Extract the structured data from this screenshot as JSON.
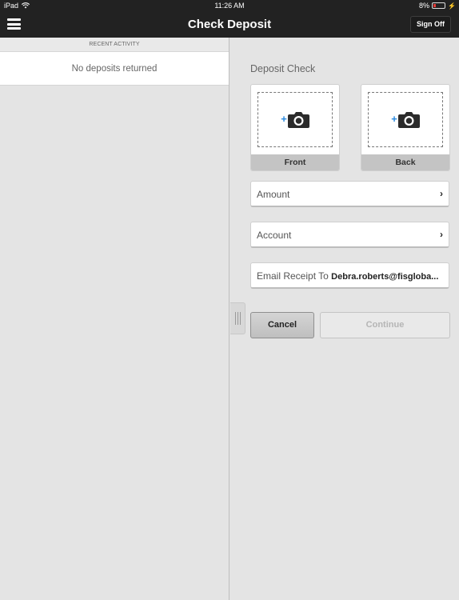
{
  "status_bar": {
    "device": "iPad",
    "time": "11:26 AM",
    "battery": "8%",
    "battery_level": 0.08,
    "battery_color": "#e53935"
  },
  "nav": {
    "title": "Check Deposit",
    "sign_off_label": "Sign Off",
    "menu_icon": "hamburger-icon"
  },
  "recent_activity": {
    "header": "RECENT ACTIVITY",
    "empty_message": "No deposits returned"
  },
  "deposit": {
    "title": "Deposit Check",
    "front_label": "Front",
    "back_label": "Back",
    "plus": "+",
    "amount_label": "Amount",
    "account_label": "Account",
    "chevron": "›",
    "email_label": "Email Receipt To",
    "email_value": "Debra.roberts@fisgloba...",
    "cancel_label": "Cancel",
    "continue_label": "Continue",
    "accent_color": "#2a8ae0"
  }
}
